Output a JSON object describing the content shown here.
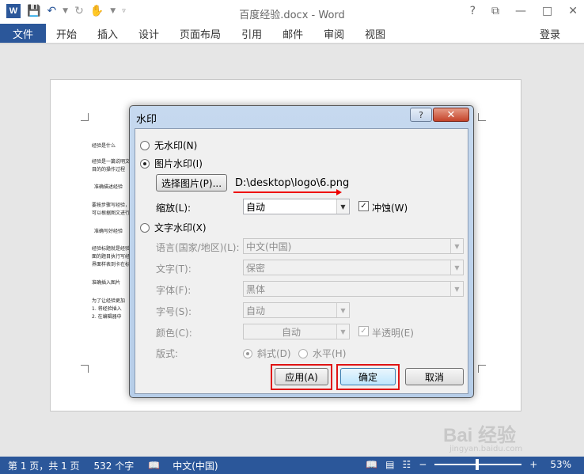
{
  "titlebar": {
    "logo": "W",
    "doc_title": "百度经验.docx - Word",
    "help": "?",
    "ribbon_display": "⧉",
    "minimize": "—",
    "restore": "□",
    "close": "✕"
  },
  "ribbon": {
    "tabs": [
      "文件",
      "开始",
      "插入",
      "设计",
      "页面布局",
      "引用",
      "邮件",
      "审阅",
      "视图"
    ],
    "login": "登录"
  },
  "page_lines": [
    "经验是什么",
    "经验是一篇说明文字，用来描述一个事情的步骤或方法，经验的目的是要对大家有用，即",
    "目的的操作过程",
    "准确描述经验",
    "要按步骤写经验，可以写多个步骤，每一步骤写一个操作，让大家",
    "可以根据图文进行操作",
    "准确写好经验",
    "经验标题就是经验内容的总结，当大家在搜索引擎中进行搜索时，准确的标题可以",
    "面的题目执行写经验，每一个经验是一个可以独立的描述，一个好的经验题",
    "界面样表到卡在标题中",
    "准确插入图片",
    "为了让经验更加",
    "1. 将经验插入",
    "2. 在编辑器中"
  ],
  "dialog": {
    "title": "水印",
    "help": "?",
    "close": "✕",
    "no_watermark": "无水印(N)",
    "picture_watermark": "图片水印(I)",
    "select_picture": "选择图片(P)...",
    "picture_path": "D:\\desktop\\logo\\6.png",
    "scale_label": "缩放(L):",
    "scale_value": "自动",
    "washout_label": "冲蚀(W)",
    "text_watermark": "文字水印(X)",
    "language_label": "语言(国家/地区)(L):",
    "language_value": "中文(中国)",
    "text_label": "文字(T):",
    "text_value": "保密",
    "font_label": "字体(F):",
    "font_value": "黑体",
    "size_label": "字号(S):",
    "size_value": "自动",
    "color_label": "颜色(C):",
    "color_value": "自动",
    "semitransparent_label": "半透明(E)",
    "layout_label": "版式:",
    "diagonal": "斜式(D)",
    "horizontal": "水平(H)",
    "apply": "应用(A)",
    "ok": "确定",
    "cancel": "取消"
  },
  "statusbar": {
    "page": "第 1 页，共 1 页",
    "words": "532 个字",
    "language": "中文(中国)",
    "zoom_minus": "−",
    "zoom_plus": "+",
    "zoom": "53%",
    "zoom_fraction": 0.53
  },
  "watermark": {
    "text": "Bai 经验",
    "sub": "jingyan.baidu.com"
  },
  "colors": {
    "accent": "#2b579a",
    "highlight": "#e01414"
  }
}
